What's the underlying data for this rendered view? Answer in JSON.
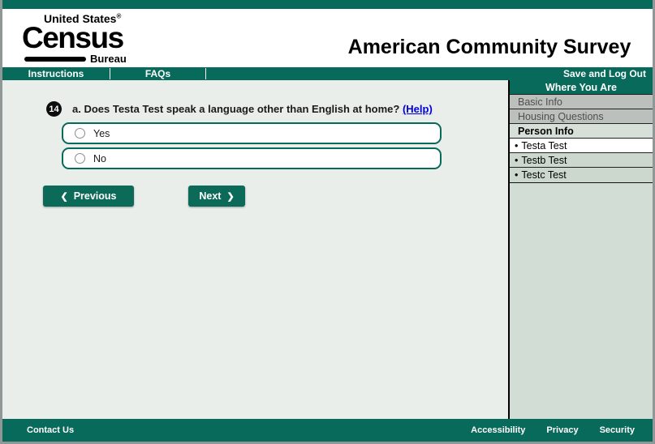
{
  "header": {
    "logo": {
      "line1": "United States",
      "registered": "®",
      "line2": "Census",
      "line3": "Bureau"
    },
    "title": "American Community Survey"
  },
  "nav": {
    "instructions": "Instructions",
    "faqs": "FAQs",
    "save_logout": "Save and Log Out"
  },
  "question": {
    "number": "14",
    "text": "a. Does Testa Test speak a language other than English at home?",
    "help_label": "(Help)",
    "options": [
      {
        "label": "Yes",
        "selected": false
      },
      {
        "label": "No",
        "selected": false
      }
    ]
  },
  "buttons": {
    "previous_label": "Previous",
    "next_label": "Next",
    "prev_chevron": "❮",
    "next_chevron": "❯"
  },
  "sidebar": {
    "title": "Where You Are",
    "items": [
      {
        "label": "Basic Info",
        "state": "completed"
      },
      {
        "label": "Housing Questions",
        "state": "completed"
      },
      {
        "label": "Person Info",
        "state": "section-current"
      },
      {
        "bullet": "•",
        "label": "Testa Test",
        "state": "current"
      },
      {
        "bullet": "•",
        "label": "Testb Test",
        "state": "upcoming"
      },
      {
        "bullet": "•",
        "label": "Testc Test",
        "state": "upcoming"
      }
    ]
  },
  "footer": {
    "contact": "Contact Us",
    "links": [
      "Accessibility",
      "Privacy",
      "Security"
    ]
  },
  "colors": {
    "accent_teal": "#086a5a",
    "link_blue": "#0000dd",
    "main_bg": "#e9eeeb",
    "sidebar_bg": "#d2ddd5",
    "completed_row_bg": "#bcc0bc",
    "current_row_bg": "#ffffff",
    "upcoming_row_bg": "#ccd8ce",
    "badge_bg": "#0d0d0d"
  }
}
